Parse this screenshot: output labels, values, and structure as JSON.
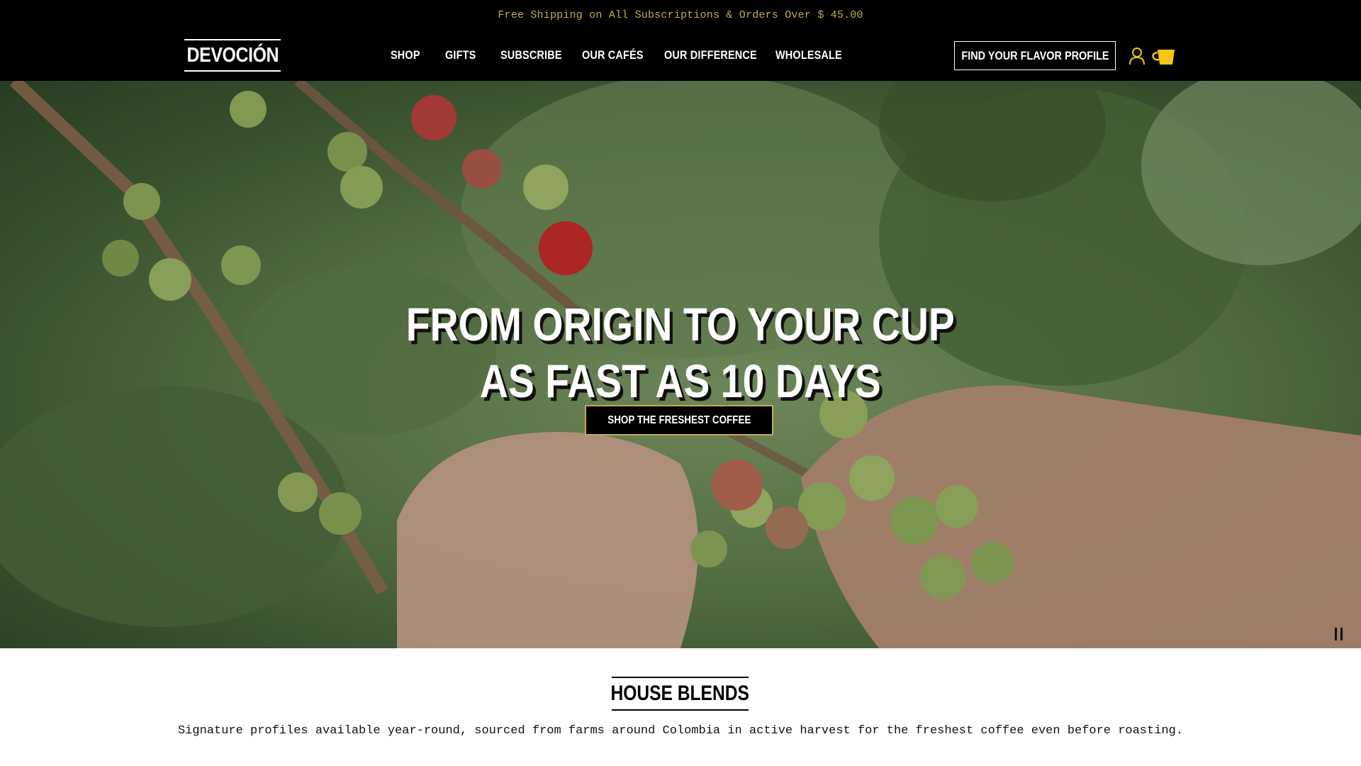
{
  "announcement": {
    "text": "Free Shipping on All Subscriptions & Orders Over $ 45.00"
  },
  "header": {
    "logo": "DEVOCIÓN",
    "nav": [
      {
        "label": "SHOP"
      },
      {
        "label": "GIFTS"
      },
      {
        "label": "SUBSCRIBE"
      },
      {
        "label": "OUR CAFÉS"
      },
      {
        "label": "OUR DIFFERENCE"
      },
      {
        "label": "WHOLESALE"
      }
    ],
    "flavor_button": "FIND YOUR FLAVOR PROFILE",
    "icons": {
      "account": "user-icon",
      "cart": "cup-cart-icon"
    }
  },
  "hero": {
    "title_line1": "FROM ORIGIN TO YOUR CUP",
    "title_line2": "AS FAST AS 10 DAYS",
    "cta": "SHOP THE FRESHEST COFFEE",
    "pause_icon": "pause-icon"
  },
  "house_blends": {
    "title": "HOUSE BLENDS",
    "description": "Signature profiles available year-round, sourced from farms around Colombia in active harvest for the freshest coffee even before roasting."
  },
  "colors": {
    "accent_gold": "#c9a94e",
    "cart_yellow": "#f5c518",
    "header_bg": "#000000"
  }
}
